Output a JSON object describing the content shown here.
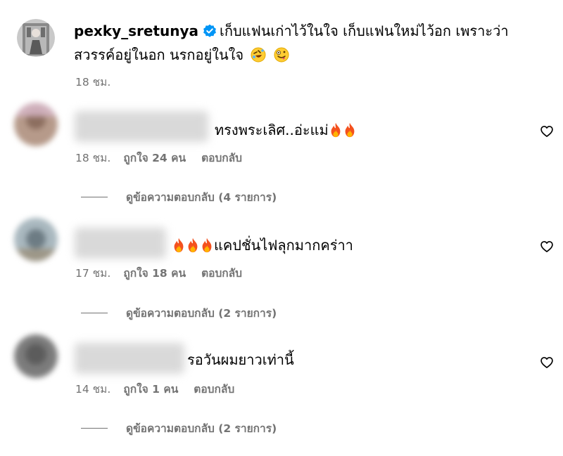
{
  "post": {
    "username": "pexky_sretunya",
    "caption_line1": "เก็บแฟนเก่าไว้ในใจ เก็บแฟนใหม่ไว้อก เพราะว่า",
    "caption_line2": "สวรรค์อยู่ในอก นรกอยู่ในใจ",
    "caption_emojis": [
      "rolling-laughing-emoji",
      "zany-face-emoji"
    ],
    "timestamp": "18 ชม."
  },
  "comments": [
    {
      "text": "ทรงพระเลิศ..อ่ะแม่",
      "emojis": [
        "fire-emoji",
        "fire-emoji"
      ],
      "time": "18 ชม.",
      "likes": "ถูกใจ 24 คน",
      "reply_label": "ตอบกลับ",
      "view_replies": "ดูข้อความตอบกลับ (4 รายการ)"
    },
    {
      "text": "แคปชั่นไฟลุกมากคร่าา",
      "emojis": [
        "fire-emoji",
        "fire-emoji",
        "fire-emoji"
      ],
      "time": "17 ชม.",
      "likes": "ถูกใจ 18 คน",
      "reply_label": "ตอบกลับ",
      "view_replies": "ดูข้อความตอบกลับ (2 รายการ)"
    },
    {
      "text": "รอวันผมยาวเท่านี้",
      "emojis": [],
      "time": "14 ชม.",
      "likes": "ถูกใจ 1 คน",
      "reply_label": "ตอบกลับ",
      "view_replies": "ดูข้อความตอบกลับ (2 รายการ)"
    }
  ],
  "colors": {
    "verified": "#0095f6",
    "fire": "#f4511e",
    "secondary_text": "#737373"
  }
}
